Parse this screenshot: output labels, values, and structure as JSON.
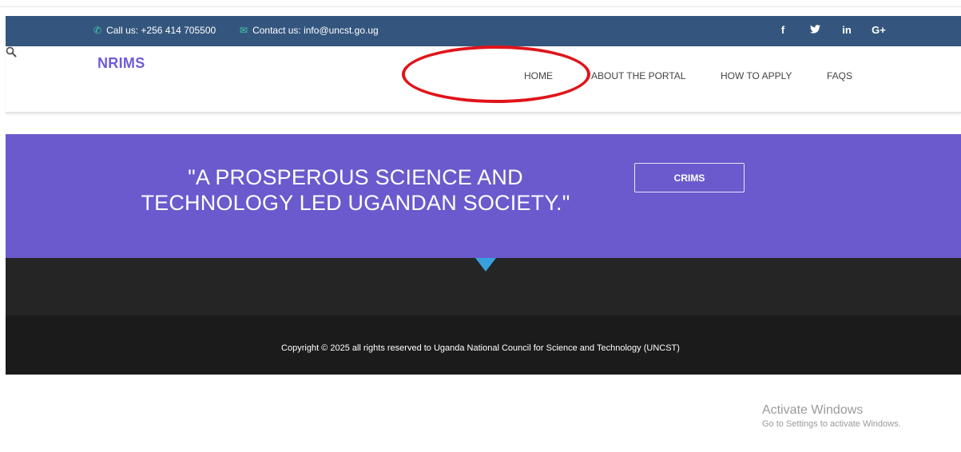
{
  "topbar": {
    "phone_icon": "phone-icon",
    "phone_text": "Call us: +256 414 705500",
    "email_icon": "envelope-icon",
    "email_text": "Contact us: info@uncst.go.ug",
    "social": {
      "facebook": "f",
      "twitter": "🐦",
      "linkedin": "in",
      "googleplus": "G+"
    }
  },
  "header": {
    "logo": "NRIMS",
    "nav": {
      "home": "HOME",
      "about": "ABOUT THE PORTAL",
      "apply": "HOW TO APPLY",
      "faqs": "FAQS"
    },
    "search_icon": "search-icon"
  },
  "banner": {
    "tagline": "\"A PROSPEROUS SCIENCE AND TECHNOLOGY LED UGANDAN SOCIETY.\"",
    "button": "CRIMS"
  },
  "footer": {
    "copyright": "Copyright © 2025 all rights reserved to Uganda National Council for Science and Technology (UNCST)"
  },
  "watermark": {
    "title": "Activate Windows",
    "subtitle": "Go to Settings to activate Windows."
  },
  "colors": {
    "topbar": "#34567e",
    "brand": "#6f5bd6",
    "banner": "#6a5acd",
    "dark": "#252525",
    "footer": "#1b1b1b",
    "annotation": "#e0141a",
    "arrow": "#3aa0dd"
  }
}
